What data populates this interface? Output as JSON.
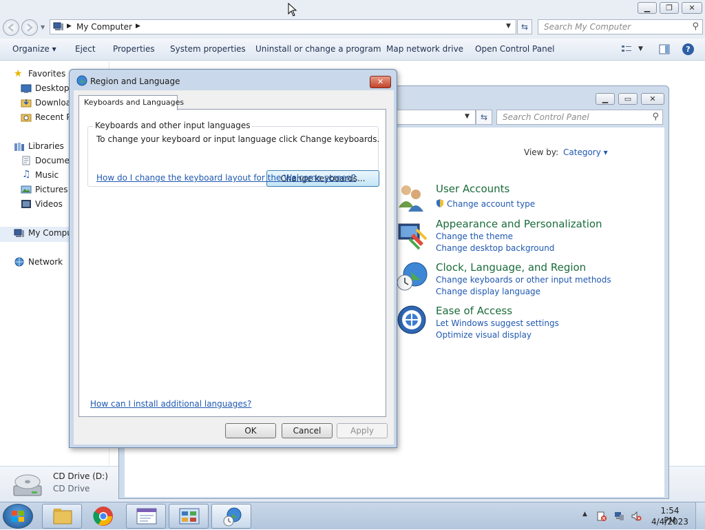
{
  "explorer": {
    "address": "My Computer",
    "search_placeholder": "Search My Computer",
    "toolbar": [
      "Organize ▾",
      "Eject",
      "Properties",
      "System properties",
      "Uninstall or change a program",
      "Map network drive",
      "Open Control Panel"
    ],
    "nav": {
      "favorites": "Favorites",
      "desktop": "Desktop",
      "downloads": "Download",
      "recent": "Recent Pl",
      "libraries": "Libraries",
      "documents": "Documer",
      "music": "Music",
      "pictures": "Pictures",
      "videos": "Videos",
      "computer": "My Compu",
      "network": "Network"
    },
    "details": {
      "name": "CD Drive (D:)",
      "type": "CD Drive"
    }
  },
  "control_panel": {
    "search_placeholder": "Search Control Panel",
    "view_by_label": "View by:",
    "view_by_value": "Category ▾",
    "categories": [
      {
        "title": "User Accounts",
        "links": [
          "Change account type"
        ]
      },
      {
        "title": "Appearance and Personalization",
        "links": [
          "Change the theme",
          "Change desktop background"
        ]
      },
      {
        "title": "Clock, Language, and Region",
        "links": [
          "Change keyboards or other input methods",
          "Change display language"
        ]
      },
      {
        "title": "Ease of Access",
        "links": [
          "Let Windows suggest settings",
          "Optimize visual display"
        ]
      }
    ]
  },
  "dialog": {
    "title": "Region and Language",
    "close_label": "✕",
    "tab_label": "Keyboards and Languages",
    "group_label": "Keyboards and other input languages",
    "group_desc": "To change your keyboard or input language click Change keyboards.",
    "change_keyboards": "Change keyboards...",
    "welcome_link": "How do I change the keyboard layout for the Welcome screen?",
    "install_link": "How can I install additional languages?",
    "ok": "OK",
    "cancel": "Cancel",
    "apply": "Apply"
  },
  "taskbar": {
    "time": "1:54 PM",
    "date": "4/4/2023"
  }
}
